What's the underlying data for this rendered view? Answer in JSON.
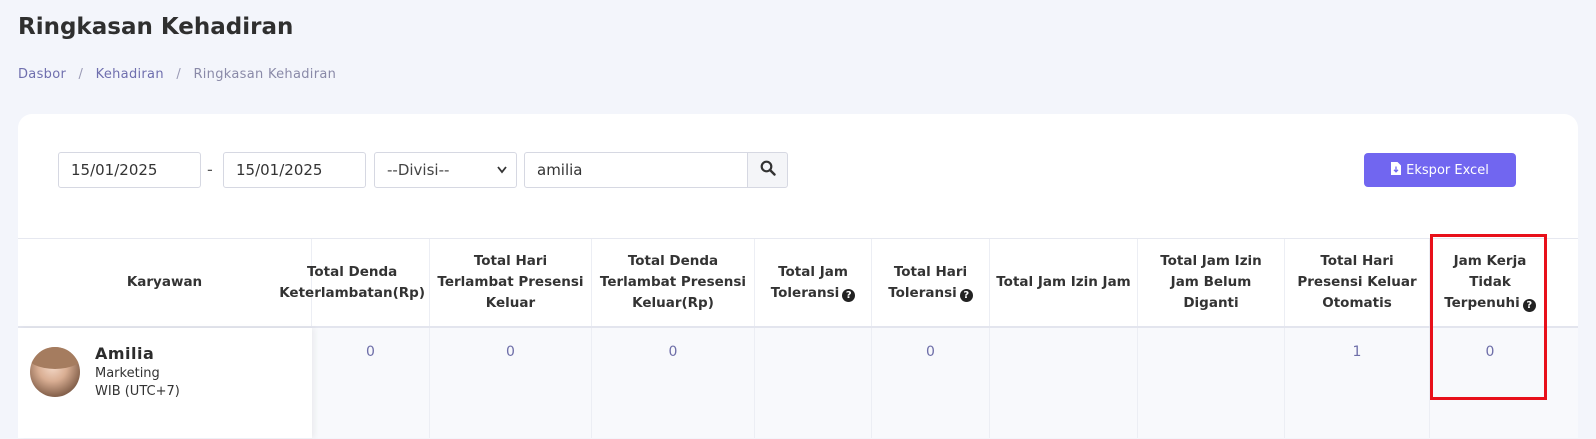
{
  "page": {
    "title": "Ringkasan Kehadiran"
  },
  "breadcrumb": {
    "items": [
      "Dasbor",
      "Kehadiran",
      "Ringkasan Kehadiran"
    ],
    "separator": "/"
  },
  "filters": {
    "date_from": "15/01/2025",
    "date_dash": "-",
    "date_to": "15/01/2025",
    "divisi_selected": "--Divisi--",
    "search_value": "amilia",
    "search_icon": "search-icon"
  },
  "export": {
    "label": "Ekspor Excel",
    "icon": "file-download-icon",
    "color": "#7166f0"
  },
  "table": {
    "headers": {
      "karyawan": "Karyawan",
      "total_denda_keterlambatan": "Total Denda Keterlambatan(Rp)",
      "total_hari_terlambat_presensi_keluar": "Total Hari Terlambat Presensi Keluar",
      "total_denda_terlambat_presensi_keluar": "Total Denda Terlambat Presensi Keluar(Rp)",
      "total_jam_toleransi": "Total Jam Toleransi",
      "total_hari_toleransi": "Total Hari Toleransi",
      "total_jam_izin_jam": "Total Jam Izin Jam",
      "total_jam_izin_belum_diganti": "Total Jam Izin Jam Belum Diganti",
      "total_hari_presensi_keluar_otomatis": "Total Hari Presensi Keluar Otomatis",
      "jam_kerja_tidak_terpenuhi": "Jam Kerja Tidak Terpenuhi"
    },
    "rows": [
      {
        "employee": {
          "name": "Amilia",
          "division": "Marketing",
          "timezone": "WIB (UTC+7)"
        },
        "total_denda_keterlambatan": "0",
        "total_hari_terlambat_presensi_keluar": "0",
        "total_denda_terlambat_presensi_keluar": "0",
        "total_jam_toleransi": "",
        "total_hari_toleransi": "0",
        "total_jam_izin_jam": "",
        "total_jam_izin_belum_diganti": "",
        "total_hari_presensi_keluar_otomatis": "1",
        "jam_kerja_tidak_terpenuhi": "0"
      }
    ]
  },
  "annotation": {
    "highlight_color": "#e8101a"
  }
}
